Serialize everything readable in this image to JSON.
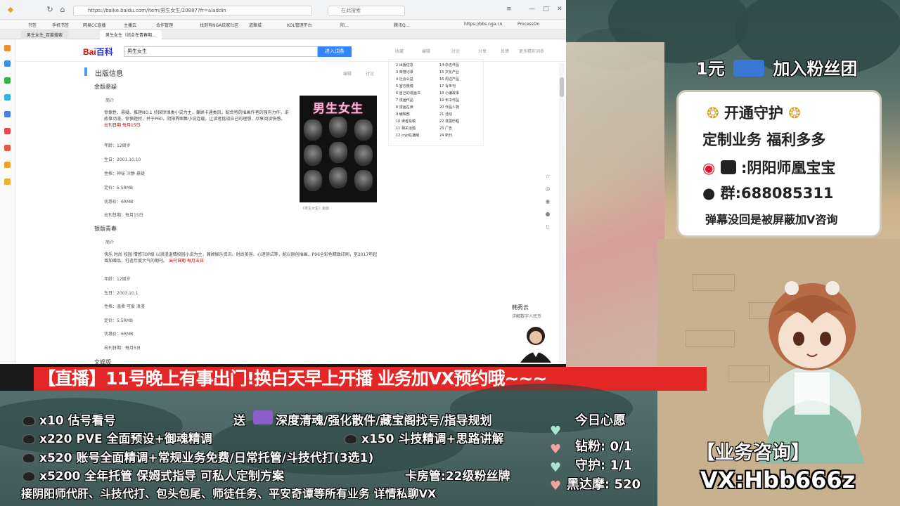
{
  "browser": {
    "url": "https://baike.baidu.com/item/男生女生/20887?fr=aladdin",
    "search_placeholder": "在此搜索",
    "bookmarks": [
      "书签",
      "手机书签",
      "网易CC直播",
      "主播云",
      "合作管理",
      "找到有NGA玩家社区",
      "道聚城",
      "KOL管理平台",
      "阳…",
      "腾讯Q…",
      "https://bbs.nga.cn",
      "ProcessOn"
    ],
    "tabs": [
      "男生女生_百度搜索",
      "男生女生（综合性青春期…"
    ]
  },
  "baike": {
    "logo_a": "Bai",
    "logo_b": "百科",
    "search_value": "男生女生",
    "search_button": "进入词条",
    "actions": [
      "收藏",
      "编辑",
      "讨论",
      "分享",
      "反馈",
      "更多精彩词条"
    ],
    "section_title": "出版信息",
    "tools": [
      "编辑",
      "讨论"
    ],
    "sub1": "金版悬疑",
    "sub1_intro": "简介",
    "sub1_para1": "惊悚性、悬疑、推理NO.1 侦探惊悚类小说为主，兼顾卡通类风，配合特的插画作者的强有力作，讲故事动漫，惊悚题材，并于P60，阴阳界图集小说连载。让读者挑战自己的理想，尽享阅读快感。",
    "sub1_para1_em": "出刊日期 每月15日",
    "sub1_fields": [
      "年龄：12周岁",
      "生日：2001.10.10",
      "性格：神秘 冷静 悬疑",
      "定价：5.5RMB",
      "优惠价：6RMB",
      "出刊日期：每月15日"
    ],
    "sub2": "银版青春",
    "sub2_intro": "简介",
    "sub2_para": "快乐 时尚 校园 情感TOP级 以浪漫温情校园小说为主，兼顾娱乐资讯、时尚美容、心理测试等，配以原创插画，P96全彩色精致印刷，至2017年起增加赠品，打造年度大气的期刊。",
    "sub2_para_em": "出刊日期 每月五日",
    "sub2_fields": [
      "年龄：12周岁",
      "生日：2003.10.1",
      "性格：温柔 可爱 浪漫",
      "定价：5.5RMB",
      "优惠价：6RMB",
      "出刊日期：每月5日"
    ],
    "sub3": "文娱版",
    "cover_title": "男生女生",
    "cover_caption": "《男生女生》金版",
    "toc": [
      "2 出版信息",
      "3 荣誉记录",
      "4 社会公益",
      "5 官方微博",
      "6 自己的漫画书",
      "7 漫画作品",
      "8 漫画在读",
      "9 编辑部",
      "10 读者投稿",
      "11 相关话题",
      "12 cnjd在播版",
      "14 杂志作品",
      "15 文化产业",
      "16 周边产品",
      "17 青年刊",
      "18 小编故事",
      "19 年中作品",
      "20 作品人物",
      "21 活动",
      "22 发展历程",
      "23 广告",
      "24 新刊"
    ],
    "avatar_name": "韩秀云",
    "avatar_sub": "详解数字人民币"
  },
  "overlay": {
    "banner": "【直播】11号晚上有事出门!换白天早上开播 业务加VX预约哦~~~",
    "rows": [
      {
        "a": "x10 估号看号",
        "b": "送",
        "c": "深度清魂/强化散件/藏宝阁找号/指导规划"
      },
      {
        "a": "x220 PVE 全面预设+御魂精调",
        "c": "x150 斗技精调+思路讲解"
      },
      {
        "a": "x520 账号全面精调+常规业务免费/日常托管/斗技代打(3选1)"
      },
      {
        "a": "x5200 全年托管 保姆式指导 可私人定制方案",
        "c": "卡房管:22级粉丝牌"
      },
      {
        "a": "接阴阳师代肝、斗技代打、包头包尾、师徒任务、平安奇谭等所有业务 详情私聊VX"
      }
    ],
    "wish_title": "今日心愿",
    "wishes": [
      "钻粉: 0/1",
      "守护: 1/1",
      "黑达摩: 520"
    ],
    "fans_prefix": "1元",
    "fans_text": "加入粉丝团",
    "card_title": "开通守护",
    "card_line2": "定制业务 福利多多",
    "card_weibo": ":阴阳师凰宝宝",
    "card_qq": "群:688085311",
    "card_note": "弹幕没回是被屏蔽加V咨询",
    "consult": "【业务咨询】",
    "vx": "VX:Hbb666z"
  }
}
